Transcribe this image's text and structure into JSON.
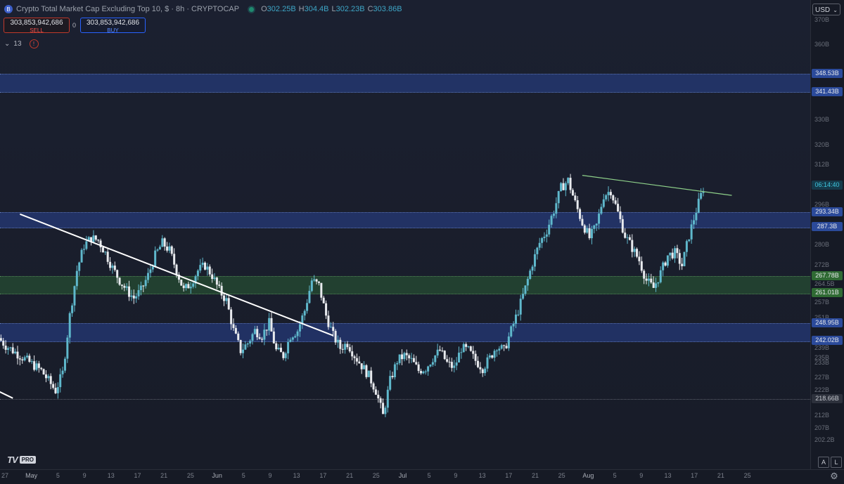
{
  "header": {
    "logo_glyph": "B",
    "title": "Crypto Total Market Cap Excluding Top 10, $ · 8h · CRYPTOCAP",
    "ohlc": [
      {
        "k": "O",
        "v": "302.25B"
      },
      {
        "k": "H",
        "v": "304.4B"
      },
      {
        "k": "L",
        "v": "302.23B"
      },
      {
        "k": "C",
        "v": "303.86B"
      }
    ]
  },
  "trade": {
    "sell_price": "303,853,942,686",
    "sell_label": "SELL",
    "spread": "0",
    "buy_price": "303,853,942,686",
    "buy_label": "BUY"
  },
  "indicators": {
    "toggle": "⌄",
    "count": "13",
    "warning": "!"
  },
  "currency": {
    "label": "USD",
    "chevron": "⌄"
  },
  "price_axis": {
    "ticks": [
      {
        "label": "380B",
        "value": 380
      },
      {
        "label": "370B",
        "value": 370
      },
      {
        "label": "360B",
        "value": 360
      },
      {
        "label": "330B",
        "value": 330
      },
      {
        "label": "320B",
        "value": 320
      },
      {
        "label": "312B",
        "value": 312
      },
      {
        "label": "296B",
        "value": 296
      },
      {
        "label": "280B",
        "value": 280
      },
      {
        "label": "272B",
        "value": 272
      },
      {
        "label": "264.5B",
        "value": 264.5
      },
      {
        "label": "257B",
        "value": 257
      },
      {
        "label": "251B",
        "value": 251
      },
      {
        "label": "235B",
        "value": 235
      },
      {
        "label": "239B",
        "value": 239
      },
      {
        "label": "233B",
        "value": 233
      },
      {
        "label": "227B",
        "value": 227
      },
      {
        "label": "222B",
        "value": 222
      },
      {
        "label": "212B",
        "value": 212
      },
      {
        "label": "207B",
        "value": 207
      },
      {
        "label": "202.2B",
        "value": 202.2
      }
    ],
    "labels": [
      {
        "text": "348.53B",
        "value": 348.53,
        "style": "blue"
      },
      {
        "text": "341.43B",
        "value": 341.43,
        "style": "blue"
      },
      {
        "text": "06:14:40",
        "value": 303.86,
        "style": "time"
      },
      {
        "text": "293.34B",
        "value": 293.34,
        "style": "blue"
      },
      {
        "text": "287.3B",
        "value": 287.3,
        "style": "blue"
      },
      {
        "text": "267.78B",
        "value": 267.78,
        "style": "green"
      },
      {
        "text": "261.01B",
        "value": 261.01,
        "style": "green"
      },
      {
        "text": "248.95B",
        "value": 248.95,
        "style": "blue"
      },
      {
        "text": "242.02B",
        "value": 242.02,
        "style": "blue"
      },
      {
        "text": "218.66B",
        "value": 218.66,
        "style": "gray"
      }
    ]
  },
  "zones": [
    {
      "top": 348.53,
      "bottom": 341.43,
      "color": "blue"
    },
    {
      "top": 293.34,
      "bottom": 287.3,
      "color": "blue"
    },
    {
      "top": 267.78,
      "bottom": 261.01,
      "color": "green"
    },
    {
      "top": 248.95,
      "bottom": 242.02,
      "color": "blue"
    }
  ],
  "levels": [
    218.66
  ],
  "time_axis": [
    {
      "label": "27",
      "month": false
    },
    {
      "label": "May",
      "month": true
    },
    {
      "label": "5",
      "month": false
    },
    {
      "label": "9",
      "month": false
    },
    {
      "label": "13",
      "month": false
    },
    {
      "label": "17",
      "month": false
    },
    {
      "label": "21",
      "month": false
    },
    {
      "label": "25",
      "month": false
    },
    {
      "label": "Jun",
      "month": true
    },
    {
      "label": "5",
      "month": false
    },
    {
      "label": "9",
      "month": false
    },
    {
      "label": "13",
      "month": false
    },
    {
      "label": "17",
      "month": false
    },
    {
      "label": "21",
      "month": false
    },
    {
      "label": "25",
      "month": false
    },
    {
      "label": "Jul",
      "month": true
    },
    {
      "label": "5",
      "month": false
    },
    {
      "label": "9",
      "month": false
    },
    {
      "label": "13",
      "month": false
    },
    {
      "label": "17",
      "month": false
    },
    {
      "label": "21",
      "month": false
    },
    {
      "label": "25",
      "month": false
    },
    {
      "label": "Aug",
      "month": true
    },
    {
      "label": "5",
      "month": false
    },
    {
      "label": "9",
      "month": false
    },
    {
      "label": "13",
      "month": false
    },
    {
      "label": "17",
      "month": false
    },
    {
      "label": "21",
      "month": false
    },
    {
      "label": "25",
      "month": false
    }
  ],
  "scale_buttons": {
    "auto": "A",
    "log": "L"
  },
  "branding": {
    "logo": "TV",
    "pro": "PRO"
  },
  "colors": {
    "up": "#5fb8cc",
    "down": "#e8eaee",
    "trendline": "#ffffff",
    "green_trendline": "#8fd18a",
    "zone_blue": "#2d4ca8",
    "zone_green": "#2a5c34"
  },
  "chart_data": {
    "type": "candlestick",
    "price_axis_unit": "B",
    "close_series": [
      243,
      240,
      238,
      236,
      234,
      232,
      230,
      226,
      222,
      229,
      252,
      270,
      280,
      283,
      282,
      277,
      271,
      266,
      262,
      259,
      262,
      268,
      276,
      281,
      278,
      270,
      262,
      265,
      270,
      272,
      268,
      262,
      258,
      246,
      238,
      241,
      246,
      244,
      249,
      238,
      236,
      244,
      246,
      254,
      266,
      264,
      252,
      244,
      239,
      241,
      236,
      232,
      228,
      222,
      212,
      226,
      234,
      236,
      234,
      230,
      231,
      235,
      238,
      233,
      231,
      239,
      238,
      234,
      231,
      235,
      240,
      238,
      246,
      254,
      263,
      273,
      281,
      286,
      294,
      303,
      306,
      297,
      289,
      283,
      288,
      300,
      302,
      293,
      284,
      279,
      274,
      266,
      263,
      269,
      276,
      277,
      272,
      284,
      294,
      303
    ],
    "trendlines": [
      {
        "from": [
          3,
          292.5
        ],
        "to": [
          47,
          244
        ],
        "color": "white"
      },
      {
        "from": [
          -6,
          230
        ],
        "to": [
          2,
          219
        ],
        "color": "white"
      },
      {
        "from": [
          82,
          308
        ],
        "to": [
          103,
          300
        ],
        "color": "green"
      }
    ]
  }
}
